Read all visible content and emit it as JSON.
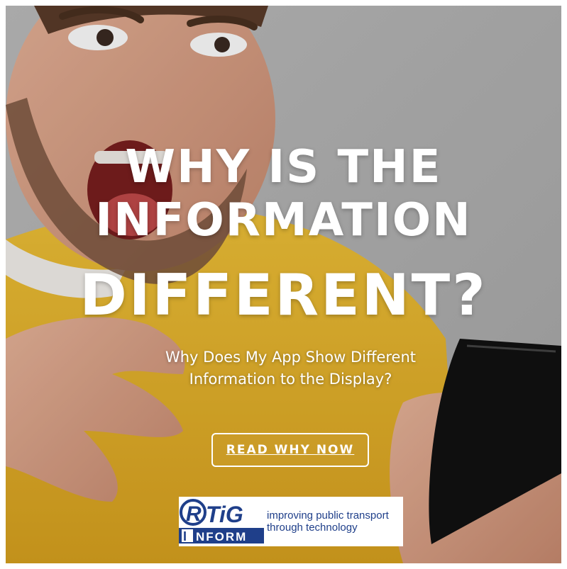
{
  "headline": {
    "line1": "WHY IS THE",
    "line2": "INFORMATION",
    "line3": "DIFFERENT?"
  },
  "subtitle": {
    "line1": "Why Does My App Show Different",
    "line2": "Information to the Display?"
  },
  "cta": {
    "label": "READ WHY NOW"
  },
  "logo": {
    "brand_top": "RTiG",
    "brand_bottom": "INFORM",
    "tagline_line1": "improving public transport",
    "tagline_line2": "through technology"
  },
  "colors": {
    "brand_blue": "#1f3f8a",
    "sweater_yellow": "#e8b630",
    "background_gray": "#b9b9b9"
  },
  "icons": [
    "rtig-logo-icon"
  ]
}
